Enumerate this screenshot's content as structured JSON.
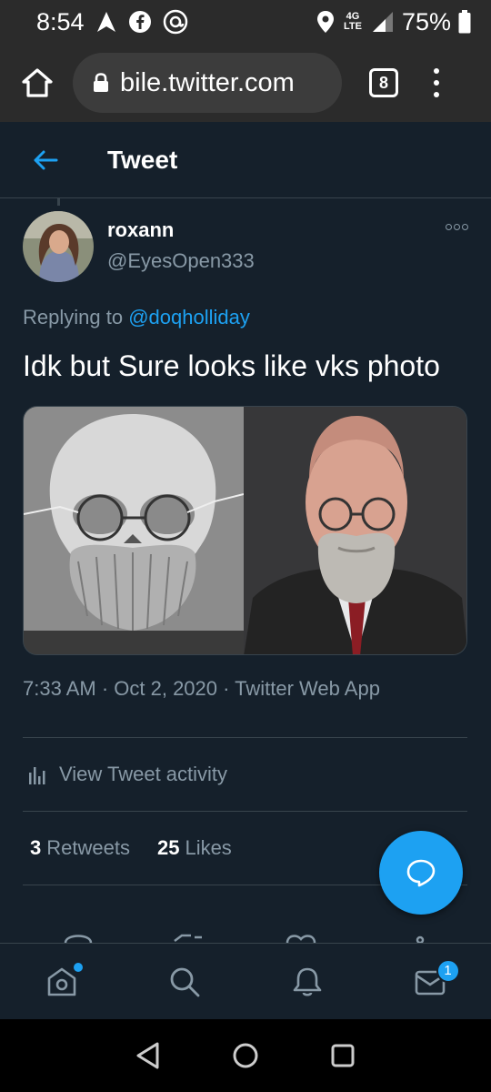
{
  "status_bar": {
    "time": "8:54",
    "network": "4G LTE",
    "battery": "75%"
  },
  "browser": {
    "url": "bile.twitter.com",
    "tab_count": "8"
  },
  "header": {
    "title": "Tweet"
  },
  "tweet": {
    "author_name": "roxann",
    "author_handle": "@EyesOpen333",
    "reply_prefix": "Replying to",
    "reply_to": "@doqholliday",
    "text": "Idk but Sure looks like vks photo",
    "timestamp": "7:33 AM · Oct 2, 2020 · Twitter Web App",
    "activity_label": "View Tweet activity",
    "retweets_count": "3",
    "retweets_label": "Retweets",
    "likes_count": "25",
    "likes_label": "Likes"
  },
  "bottom_nav": {
    "messages_badge": "1"
  },
  "colors": {
    "background": "#15202b",
    "accent": "#1da1f2",
    "secondary_text": "#8899a6",
    "border": "#38444d",
    "chrome": "#2b2b2b"
  },
  "icons": [
    "navigation-arrow-icon",
    "facebook-icon",
    "threads-icon",
    "location-icon",
    "signal-icon",
    "battery-icon",
    "home-icon",
    "lock-icon",
    "more-vertical-icon",
    "back-arrow-icon",
    "more-horizontal-icon",
    "bar-chart-icon",
    "compose-icon",
    "home-tab-icon",
    "search-icon",
    "bell-icon",
    "mail-icon",
    "back-triangle-icon",
    "home-circle-icon",
    "recents-square-icon"
  ]
}
